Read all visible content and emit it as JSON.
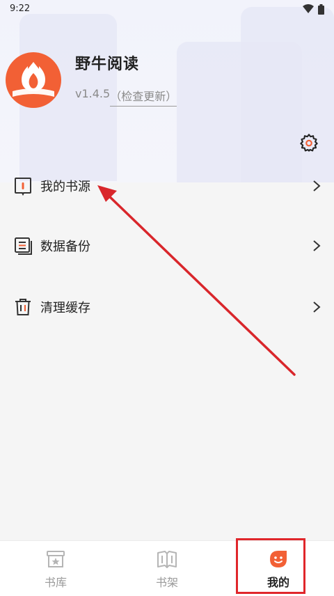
{
  "status_bar": {
    "time": "9:22"
  },
  "profile": {
    "app_name": "野牛阅读",
    "version": "v1.4.5",
    "update_label": "（检查更新）"
  },
  "menu": [
    {
      "label": "我的书源",
      "icon": "book-source-icon"
    },
    {
      "label": "数据备份",
      "icon": "backup-icon"
    },
    {
      "label": "清理缓存",
      "icon": "trash-icon"
    }
  ],
  "tabs": [
    {
      "label": "书库",
      "icon": "library-icon",
      "active": false
    },
    {
      "label": "书架",
      "icon": "bookshelf-icon",
      "active": false
    },
    {
      "label": "我的",
      "icon": "profile-icon",
      "active": true
    }
  ],
  "colors": {
    "brand": "#f26035",
    "annotation": "#e0262b"
  }
}
